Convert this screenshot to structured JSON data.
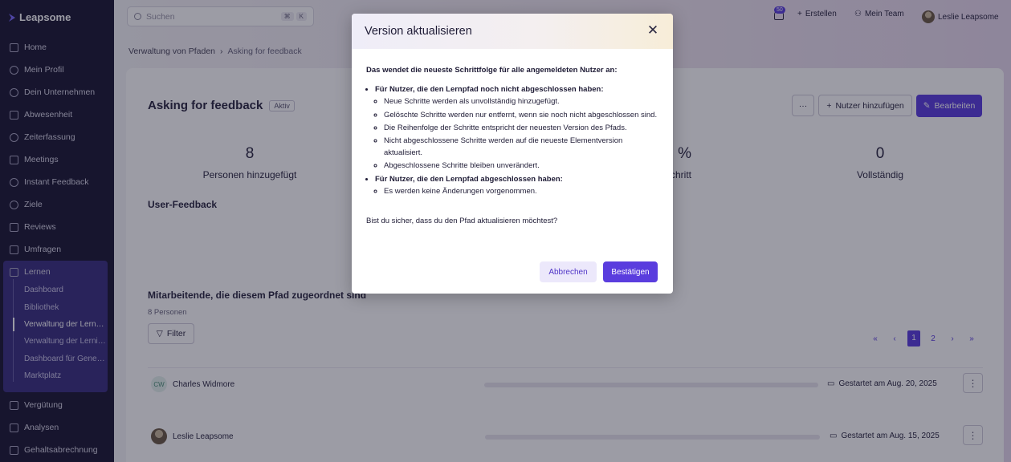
{
  "app": {
    "name": "Leapsome"
  },
  "sidebar": {
    "items": [
      {
        "label": "Home"
      },
      {
        "label": "Mein Profil"
      },
      {
        "label": "Dein Unternehmen"
      },
      {
        "label": "Abwesenheit"
      },
      {
        "label": "Zeiterfassung"
      },
      {
        "label": "Meetings"
      },
      {
        "label": "Instant Feedback"
      },
      {
        "label": "Ziele"
      },
      {
        "label": "Reviews"
      },
      {
        "label": "Umfragen"
      },
      {
        "label": "Lernen"
      },
      {
        "label": "Vergütung"
      },
      {
        "label": "Analysen"
      },
      {
        "label": "Gehaltsabrechnung"
      }
    ],
    "learn_sub": [
      {
        "label": "Dashboard"
      },
      {
        "label": "Bibliothek"
      },
      {
        "label": "Verwaltung der Lernpfade"
      },
      {
        "label": "Verwaltung der Lerninhalte"
      },
      {
        "label": "Dashboard für Genehmigungen"
      },
      {
        "label": "Marktplatz"
      }
    ]
  },
  "topbar": {
    "search_placeholder": "Suchen",
    "shortcut": [
      "⌘",
      "K"
    ],
    "notification_count": "50",
    "create": "Erstellen",
    "team": "Mein Team",
    "user": "Leslie Leapsome"
  },
  "breadcrumb": {
    "parent": "Verwaltung von Pfaden",
    "current": "Asking for feedback"
  },
  "page": {
    "title": "Asking for feedback",
    "status": "Aktiv",
    "more": "···",
    "add_users": "Nutzer hinzufügen",
    "edit": "Bearbeiten",
    "stats": [
      {
        "value": "8",
        "label": "Personen hinzugefügt"
      },
      {
        "value": "%",
        "label": "chritt"
      },
      {
        "value": "0",
        "label": "Vollständig"
      }
    ],
    "feedback_title": "User-Feedback",
    "assigned_title": "Mitarbeitende, die diesem Pfad zugeordnet sind",
    "assigned_count": "8 Personen",
    "filter": "Filter",
    "pager": {
      "first": "«",
      "prev": "‹",
      "p1": "1",
      "p2": "2",
      "next": "›",
      "last": "»"
    },
    "rows": [
      {
        "initials": "CW",
        "name": "Charles Widmore",
        "date": "Gestartet am Aug. 20, 2025",
        "progress": 0
      },
      {
        "initials": "",
        "name": "Leslie Leapsome",
        "date": "Gestartet am Aug. 15, 2025",
        "progress": 0
      }
    ]
  },
  "modal": {
    "title": "Version aktualisieren",
    "close": "✕",
    "intro": "Das wendet die neueste Schrittfolge für alle angemeldeten Nutzer an:",
    "group1": "Für Nutzer, die den Lernpfad noch nicht abgeschlossen haben:",
    "group1_items": [
      "Neue Schritte werden als unvollständig hinzugefügt.",
      "Gelöschte Schritte werden nur entfernt, wenn sie noch nicht abgeschlossen sind.",
      "Die Reihenfolge der Schritte entspricht der neuesten Version des Pfads.",
      "Nicht abgeschlossene Schritte werden auf die neueste Elementversion aktualisiert.",
      "Abgeschlossene Schritte bleiben unverändert."
    ],
    "group2": "Für Nutzer, die den Lernpfad abgeschlossen haben:",
    "group2_items": [
      "Es werden keine Änderungen vorgenommen."
    ],
    "question": "Bist du sicher, dass du den Pfad aktualisieren möchtest?",
    "cancel": "Abbrechen",
    "confirm": "Bestätigen"
  },
  "colors": {
    "accent": "#5a3dde",
    "sidebar": "#1a1733",
    "sidebar_active": "#3a2f80"
  }
}
